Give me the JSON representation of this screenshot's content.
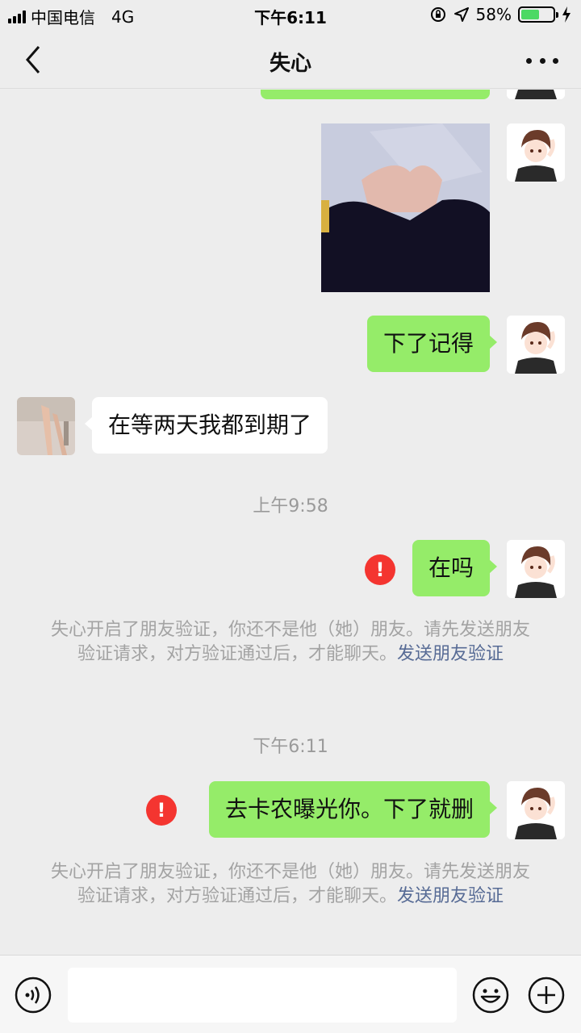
{
  "status_bar": {
    "carrier": "中国电信",
    "network": "4G",
    "time": "下午6:11",
    "battery": "58%",
    "battery_level": 0.58
  },
  "nav": {
    "title": "失心"
  },
  "messages": [
    {
      "id": "m2",
      "side": "right",
      "type": "image"
    },
    {
      "id": "m3",
      "side": "right",
      "text": "下了记得"
    },
    {
      "id": "m4",
      "side": "left",
      "text": "在等两天我都到期了"
    },
    {
      "id": "m5",
      "side": "right",
      "text": "在吗",
      "failed": true
    },
    {
      "id": "m6",
      "side": "right",
      "text": "去卡农曝光你。下了就删",
      "failed": true
    }
  ],
  "timestamps": [
    "上午9:58",
    "下午6:11"
  ],
  "notices": [
    {
      "text": "失心开启了朋友验证，你还不是他（她）朋友。请先发送朋友验证请求，对方验证通过后，才能聊天。",
      "link": "发送朋友验证"
    },
    {
      "text": "失心开启了朋友验证，你还不是他（她）朋友。请先发送朋友验证请求，对方验证通过后，才能聊天。",
      "link": "发送朋友验证"
    }
  ],
  "error_mark": "!",
  "colors": {
    "outgoing_bubble": "#95ec69",
    "incoming_bubble": "#ffffff",
    "link": "#576b95",
    "error": "#f43530",
    "background": "#ededed"
  },
  "icons": {
    "back": "chevron-left-icon",
    "more": "more-dots-icon",
    "voice": "voice-icon",
    "emoji": "emoji-icon",
    "plus": "plus-icon"
  }
}
